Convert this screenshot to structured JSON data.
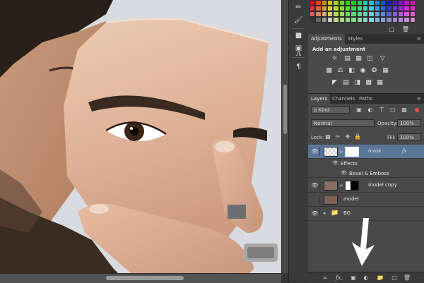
{
  "adjustments_panel": {
    "tabs": [
      {
        "label": "Adjustments"
      },
      {
        "label": "Styles"
      }
    ],
    "heading": "Add an adjustment",
    "icons": [
      "brightness-contrast-icon",
      "levels-icon",
      "curves-icon",
      "exposure-icon",
      "vibrance-icon",
      "hue-saturation-icon",
      "color-balance-icon",
      "black-white-icon",
      "photo-filter-icon",
      "channel-mixer-icon",
      "color-lookup-icon",
      "invert-icon",
      "posterize-icon",
      "threshold-icon",
      "gradient-map-icon",
      "selective-color-icon"
    ]
  },
  "layers_panel": {
    "tabs": [
      {
        "label": "Layers"
      },
      {
        "label": "Channels"
      },
      {
        "label": "Paths"
      }
    ],
    "filter_kind": "ρ Kind",
    "blend_mode": "Normal",
    "opacity_label": "Opacity:",
    "opacity_value": "100%",
    "lock_label": "Lock:",
    "fill_label": "Fill:",
    "fill_value": "100%",
    "layers": [
      {
        "name": "mask",
        "fx": "fx",
        "selected": true
      },
      {
        "name": "Effects",
        "sub": true
      },
      {
        "name": "Bevel & Emboss",
        "sub": true
      },
      {
        "name": "model copy"
      },
      {
        "name": "model"
      },
      {
        "name": "BG",
        "group": true
      }
    ]
  },
  "colors": {
    "accent_selected_layer": "#5a7696",
    "canvas_bg": "#d9dde0",
    "panel_bg": "#494949"
  }
}
